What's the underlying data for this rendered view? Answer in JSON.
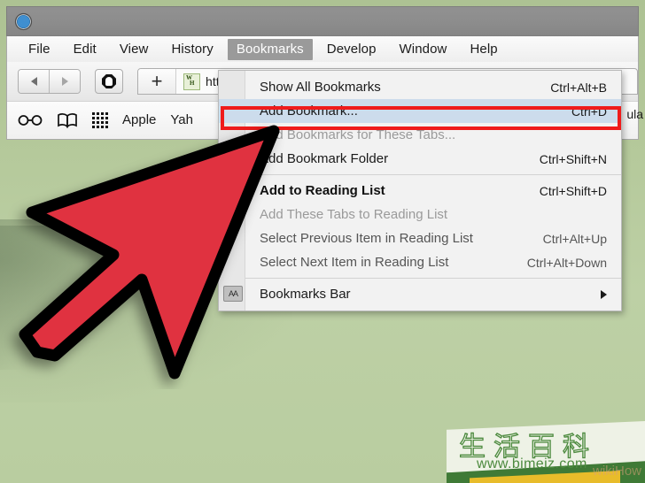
{
  "window": {
    "icon": "safari-compass-icon",
    "titlebar_title": ""
  },
  "menubar": {
    "items": [
      {
        "label": "File",
        "active": false
      },
      {
        "label": "Edit",
        "active": false
      },
      {
        "label": "View",
        "active": false
      },
      {
        "label": "History",
        "active": false
      },
      {
        "label": "Bookmarks",
        "active": true
      },
      {
        "label": "Develop",
        "active": false
      },
      {
        "label": "Window",
        "active": false
      },
      {
        "label": "Help",
        "active": false
      }
    ]
  },
  "toolbar": {
    "back_icon": "back-arrow-icon",
    "forward_icon": "forward-arrow-icon",
    "stop_icon": "stop-hand-icon",
    "new_tab_label": "+",
    "tab": {
      "favicon_top": "W",
      "favicon_bottom": "H",
      "url_text": "htt"
    }
  },
  "bookmarks_bar": {
    "items": [
      {
        "type": "icon",
        "name": "reading-list-glasses-icon",
        "label": ""
      },
      {
        "type": "icon",
        "name": "bookmarks-book-icon",
        "label": ""
      },
      {
        "type": "icon",
        "name": "top-sites-grid-icon",
        "label": ""
      },
      {
        "type": "link",
        "name": "bookmark-apple",
        "label": "Apple"
      },
      {
        "type": "link",
        "name": "bookmark-yahoo",
        "label": "Yah"
      }
    ],
    "clipped_right_label": "ula"
  },
  "dropdown": {
    "title": "Bookmarks",
    "highlight_color": "#ef1b1b",
    "selected_bg": "#ccdcec",
    "items": [
      {
        "label": "Show All Bookmarks",
        "shortcut": "Ctrl+Alt+B",
        "state": "normal",
        "gutter_icon": "",
        "submenu": false
      },
      {
        "label": "Add Bookmark...",
        "shortcut": "Ctrl+D",
        "state": "selected",
        "gutter_icon": "",
        "submenu": false
      },
      {
        "label": "Add Bookmarks for These Tabs...",
        "shortcut": "",
        "state": "disabled",
        "gutter_icon": "",
        "submenu": false
      },
      {
        "label": "Add Bookmark Folder",
        "shortcut": "Ctrl+Shift+N",
        "state": "normal",
        "gutter_icon": "",
        "submenu": false
      },
      {
        "separator": true
      },
      {
        "label": "Add to Reading List",
        "shortcut": "Ctrl+Shift+D",
        "state": "bold",
        "gutter_icon": "",
        "submenu": false
      },
      {
        "label": "Add These Tabs to Reading List",
        "shortcut": "",
        "state": "disabled",
        "gutter_icon": "",
        "submenu": false
      },
      {
        "label": "Select Previous Item in Reading List",
        "shortcut": "Ctrl+Alt+Up",
        "state": "dim",
        "gutter_icon": "",
        "submenu": false
      },
      {
        "label": "Select Next Item in Reading List",
        "shortcut": "Ctrl+Alt+Down",
        "state": "dim",
        "gutter_icon": "",
        "submenu": false
      },
      {
        "separator": true
      },
      {
        "label": "Bookmarks Bar",
        "shortcut": "",
        "state": "normal",
        "gutter_icon": "bookmarks-folder-icon",
        "submenu": true
      }
    ]
  },
  "annotation": {
    "cursor": "red-arrow-cursor",
    "cursor_fill": "#e03040",
    "cursor_stroke": "#000000"
  },
  "watermark": {
    "chinese_title": "生活百科",
    "url": "www.bimeiz.com",
    "ghost_text": "wikiHow"
  }
}
